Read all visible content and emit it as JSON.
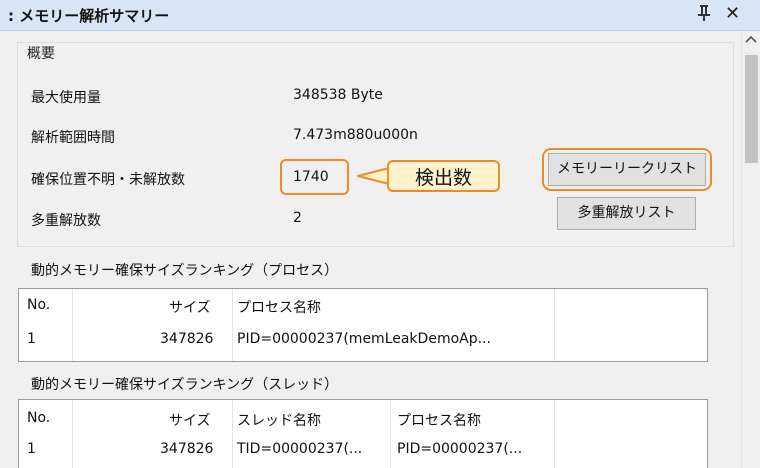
{
  "window": {
    "title": ": メモリー解析サマリー",
    "pin_glyph": "⍙",
    "close_glyph": "✕"
  },
  "summary": {
    "group_title": "概要",
    "rows": [
      {
        "label": "最大使用量",
        "value": "348538 Byte"
      },
      {
        "label": "解析範囲時間",
        "value": "7.473m880u000n"
      },
      {
        "label": "確保位置不明・未解放数",
        "value": "1740"
      },
      {
        "label": "多重解放数",
        "value": "2"
      }
    ],
    "callout": "検出数",
    "buttons": {
      "leak_list": "メモリーリークリスト",
      "double_free_list": "多重解放リスト"
    }
  },
  "process_ranking": {
    "title": "動的メモリー確保サイズランキング（プロセス）",
    "columns": [
      "No.",
      "サイズ",
      "プロセス名称"
    ],
    "rows": [
      [
        "1",
        "347826",
        "PID=00000237(memLeakDemoAp..."
      ]
    ]
  },
  "thread_ranking": {
    "title": "動的メモリー確保サイズランキング（スレッド）",
    "columns": [
      "No.",
      "サイズ",
      "スレッド名称",
      "プロセス名称"
    ],
    "rows": [
      [
        "1",
        "347826",
        "TID=00000237(...",
        "PID=00000237(..."
      ]
    ]
  },
  "colors": {
    "highlight": "#f08a24",
    "callout_fill": "#fff2cc",
    "titlebar": "#d7e5f7"
  }
}
